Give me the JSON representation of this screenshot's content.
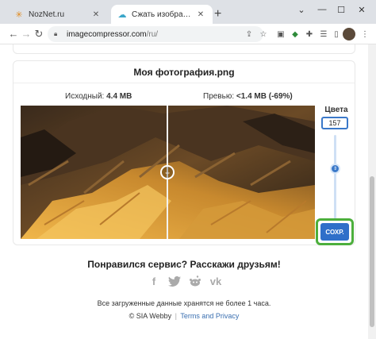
{
  "browser": {
    "tabs": [
      {
        "title": "NozNet.ru",
        "favicon": "star-spark-icon",
        "active": false
      },
      {
        "title": "Сжать изображение онлайн",
        "favicon": "cloud-icon",
        "active": true
      }
    ],
    "new_tab_symbol": "+",
    "url_host": "imagecompressor.com",
    "url_path": "/ru/",
    "window_controls": [
      "minimize-icon",
      "maximize-icon",
      "close-icon"
    ]
  },
  "card": {
    "file_title": "Моя фотография.png",
    "original_label": "Исходный:",
    "original_value": "4.4 MB",
    "preview_label": "Превью:",
    "preview_value": "<1.4 MB (-69%)",
    "colors_label": "Цвета",
    "colors_value": "157",
    "colors_slider_fraction": 0.33,
    "save_label": "СОХР.",
    "compare_split_fraction": 0.5
  },
  "share": {
    "title": "Понравился сервис? Расскажи друзьям!",
    "icons": [
      "facebook-icon",
      "twitter-icon",
      "reddit-icon",
      "vk-icon"
    ]
  },
  "footer": {
    "notice": "Все загруженные данные хранятся не более 1 часа.",
    "copyright": "© SIA Webby",
    "terms_link": "Terms and Privacy"
  },
  "colors": {
    "accent": "#2f6fc9",
    "highlight": "#4caf3c",
    "chrome_bg": "#dee1e6"
  }
}
